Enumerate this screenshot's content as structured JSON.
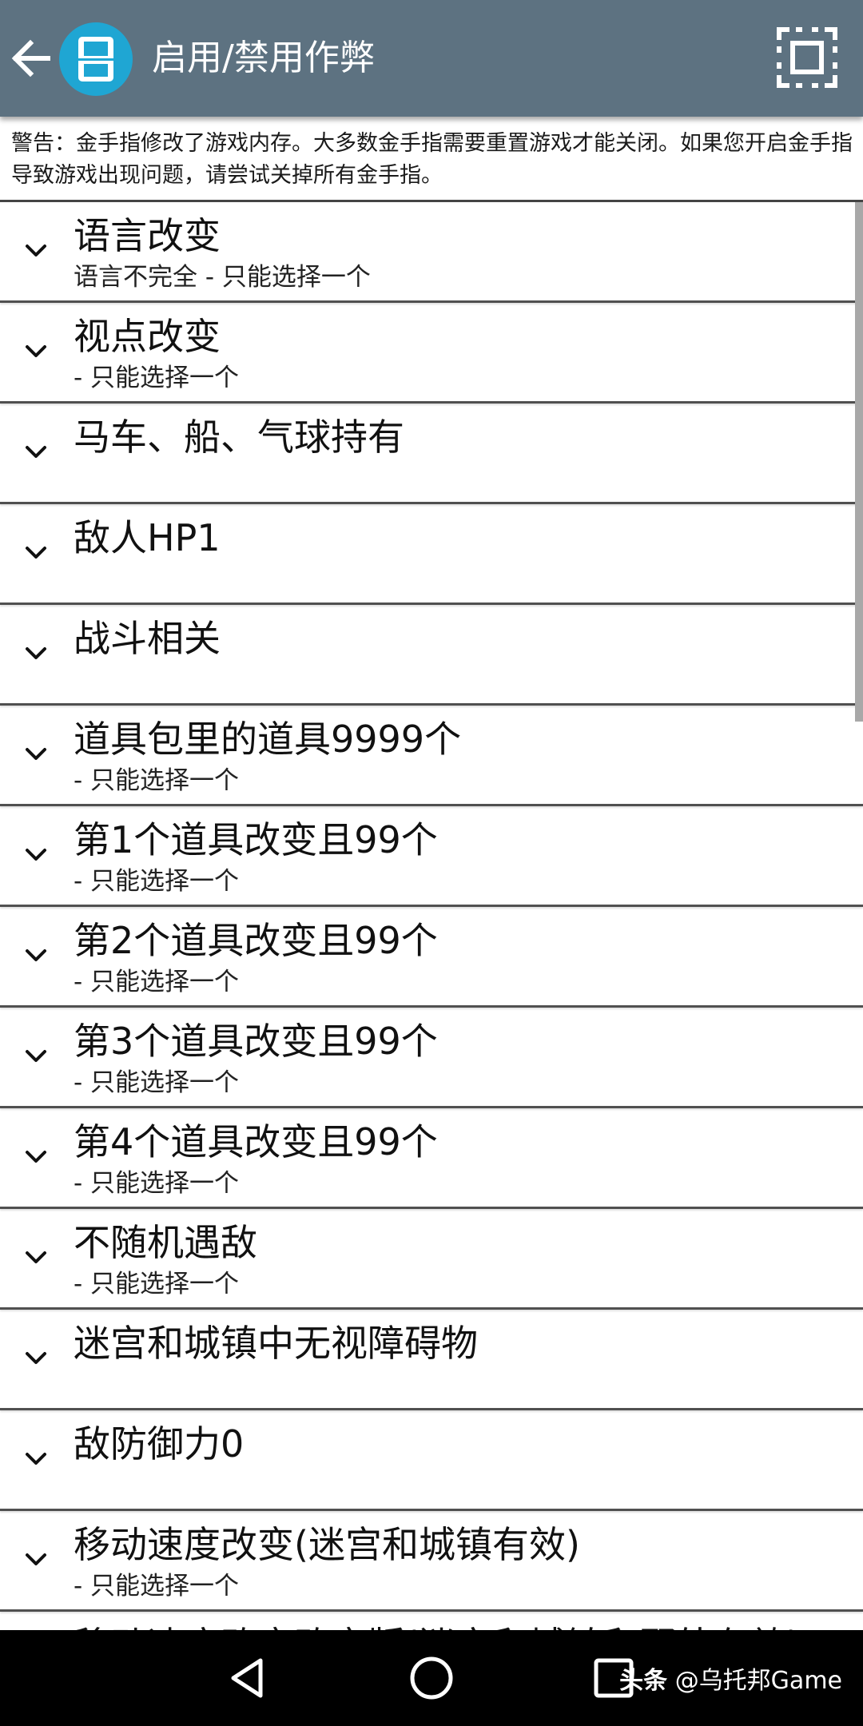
{
  "appbar": {
    "title": "启用/禁用作弊",
    "back_icon": "arrow-left-icon",
    "logo_icon": "ds-console-icon",
    "fullscreen_icon": "fullscreen-icon"
  },
  "warning": "警告：金手指修改了游戏内存。大多数金手指需要重置游戏才能关闭。如果您开启金手指导致游戏出现问题，请尝试关掉所有金手指。",
  "cheats": [
    {
      "title": "语言改变",
      "subtitle": "语言不完全 - 只能选择一个"
    },
    {
      "title": "视点改变",
      "subtitle": " - 只能选择一个"
    },
    {
      "title": "马车、船、气球持有",
      "subtitle": ""
    },
    {
      "title": "敌人HP1",
      "subtitle": ""
    },
    {
      "title": "战斗相关",
      "subtitle": ""
    },
    {
      "title": "道具包里的道具9999个",
      "subtitle": " - 只能选择一个"
    },
    {
      "title": "第1个道具改变且99个",
      "subtitle": " - 只能选择一个"
    },
    {
      "title": "第2个道具改变且99个",
      "subtitle": " - 只能选择一个"
    },
    {
      "title": "第3个道具改变且99个",
      "subtitle": " - 只能选择一个"
    },
    {
      "title": "第4个道具改变且99个",
      "subtitle": " - 只能选择一个"
    },
    {
      "title": "不随机遇敌",
      "subtitle": " - 只能选择一个"
    },
    {
      "title": "迷宫和城镇中无视障碍物",
      "subtitle": ""
    },
    {
      "title": "敌防御力0",
      "subtitle": ""
    },
    {
      "title": "移动速度改变(迷宫和城镇有效)",
      "subtitle": " - 只能选择一个"
    },
    {
      "title": "移动速度改变改变版(迷宫和城镇和野外有效)",
      "subtitle": ""
    }
  ],
  "navbar": {
    "back_icon": "triangle-back-icon",
    "home_icon": "circle-home-icon",
    "recents_icon": "square-recents-icon",
    "watermark_prefix": "头条",
    "watermark_handle": "@乌托邦Game"
  },
  "colors": {
    "appbar": "#5d7281",
    "logo": "#1fa6d3",
    "divider": "#505050",
    "navbar": "#000000"
  }
}
